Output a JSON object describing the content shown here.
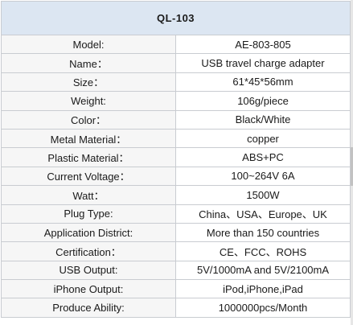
{
  "title": "QL-103",
  "rows": [
    {
      "label": "Model:",
      "value": "AE-803-805"
    },
    {
      "label": "Name：",
      "value": "USB travel charge adapter"
    },
    {
      "label": "Size：",
      "value": "61*45*56mm"
    },
    {
      "label": "Weight:",
      "value": "106g/piece"
    },
    {
      "label": "Color：",
      "value": "Black/White"
    },
    {
      "label": "Metal Material：",
      "value": "copper"
    },
    {
      "label": "Plastic Material：",
      "value": "ABS+PC"
    },
    {
      "label": "Current Voltage：",
      "value": "100~264V 6A"
    },
    {
      "label": "Watt：",
      "value": "1500W"
    },
    {
      "label": "Plug Type:",
      "value": "China、USA、Europe、UK"
    },
    {
      "label": "Application District:",
      "value": "More than 150 countries"
    },
    {
      "label": "Certification：",
      "value": "CE、FCC、ROHS"
    },
    {
      "label": "USB Output:",
      "value": "5V/1000mA and 5V/2100mA"
    },
    {
      "label": "iPhone Output:",
      "value": "iPod,iPhone,iPad"
    },
    {
      "label": "Produce Ability:",
      "value": "1000000pcs/Month"
    }
  ]
}
